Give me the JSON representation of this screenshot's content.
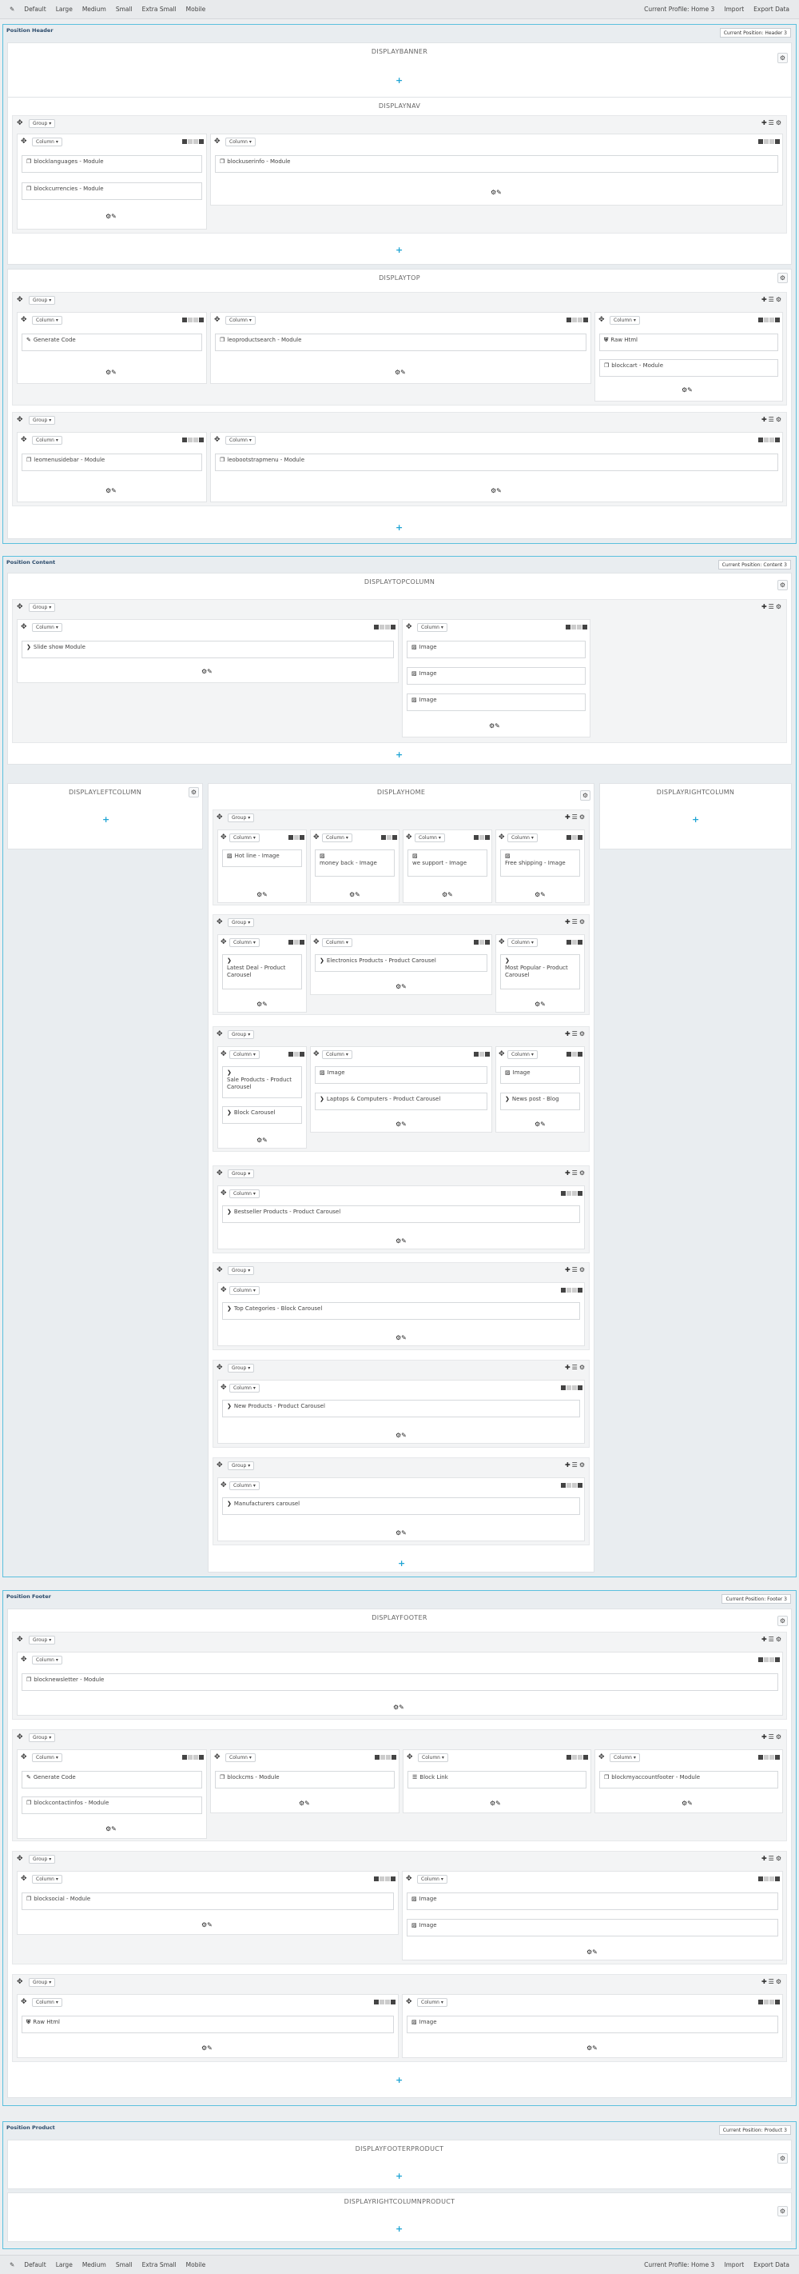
{
  "toolbar": {
    "device_icon": "pencil-icon",
    "devices": [
      "Default",
      "Large",
      "Medium",
      "Small",
      "Extra Small",
      "Mobile"
    ],
    "current_profile": "Current Profile: Home 3",
    "import": "Import",
    "export": "Export Data"
  },
  "positions": {
    "header": {
      "title": "Position Header",
      "profile": "Current Position: Header 3"
    },
    "content": {
      "title": "Position Content",
      "profile": "Current Position: Content 3"
    },
    "footer": {
      "title": "Position Footer",
      "profile": "Current Position: Footer 3"
    },
    "product": {
      "title": "Position Product",
      "profile": "Current Position: Product 3"
    }
  },
  "hooks": {
    "displaybanner": "DISPLAYBANNER",
    "displaynav": "DISPLAYNAV",
    "displaytop": "DISPLAYTOP",
    "displaytopcolumn": "DISPLAYTOPCOLUMN",
    "displayleftcolumn": "DISPLAYLEFTCOLUMN",
    "displayhome": "DISPLAYHOME",
    "displayrightcolumn": "DISPLAYRIGHTCOLUMN",
    "displayfooter": "DISPLAYFOOTER",
    "displayfooterproduct": "DISPLAYFOOTERPRODUCT",
    "displayrightcolumnproduct": "DISPLAYRIGHTCOLUMNPRODUCT"
  },
  "labels": {
    "group": "Group",
    "column": "Column"
  },
  "widgets": {
    "nav": [
      "blocklanguages - Module",
      "blockcurrencies - Module",
      "blockuserinfo - Module"
    ],
    "top1": [
      "Generate Code",
      "leoproductsearch - Module",
      "Raw Html",
      "blockcart - Module"
    ],
    "top2": [
      "leomenusidebar - Module",
      "leobootstrapmenu - Module"
    ],
    "topcolumn": [
      "Slide show Module",
      "Image",
      "Image",
      "Image"
    ],
    "home1": [
      "Hot line - Image",
      "money back - Image",
      "we support - Image",
      "Free shipping - Image"
    ],
    "home2": [
      "Latest Deal - Product Carousel",
      "Electronics Products - Product Carousel",
      "Most Popular - Product Carousel"
    ],
    "home3": [
      "Sale Products - Product Carousel",
      "Block Carousel",
      "Image",
      "Laptops & Computers - Product Carousel",
      "Image",
      "News post - Blog"
    ],
    "home4": [
      "Bestseller Products - Product Carousel"
    ],
    "home5": [
      "Top Categories - Block Carousel"
    ],
    "home6": [
      "New Products - Product Carousel"
    ],
    "home7": [
      "Manufacturers carousel"
    ],
    "footer1": [
      "blocknewsletter - Module"
    ],
    "footer2": [
      "Generate Code",
      "blockcontactinfos - Module",
      "blockcms - Module",
      "Block Link",
      "blockmyaccountfooter - Module"
    ],
    "footer3": [
      "blocksocial - Module",
      "Image",
      "Image"
    ],
    "footer4": [
      "Raw Html",
      "Image"
    ]
  }
}
